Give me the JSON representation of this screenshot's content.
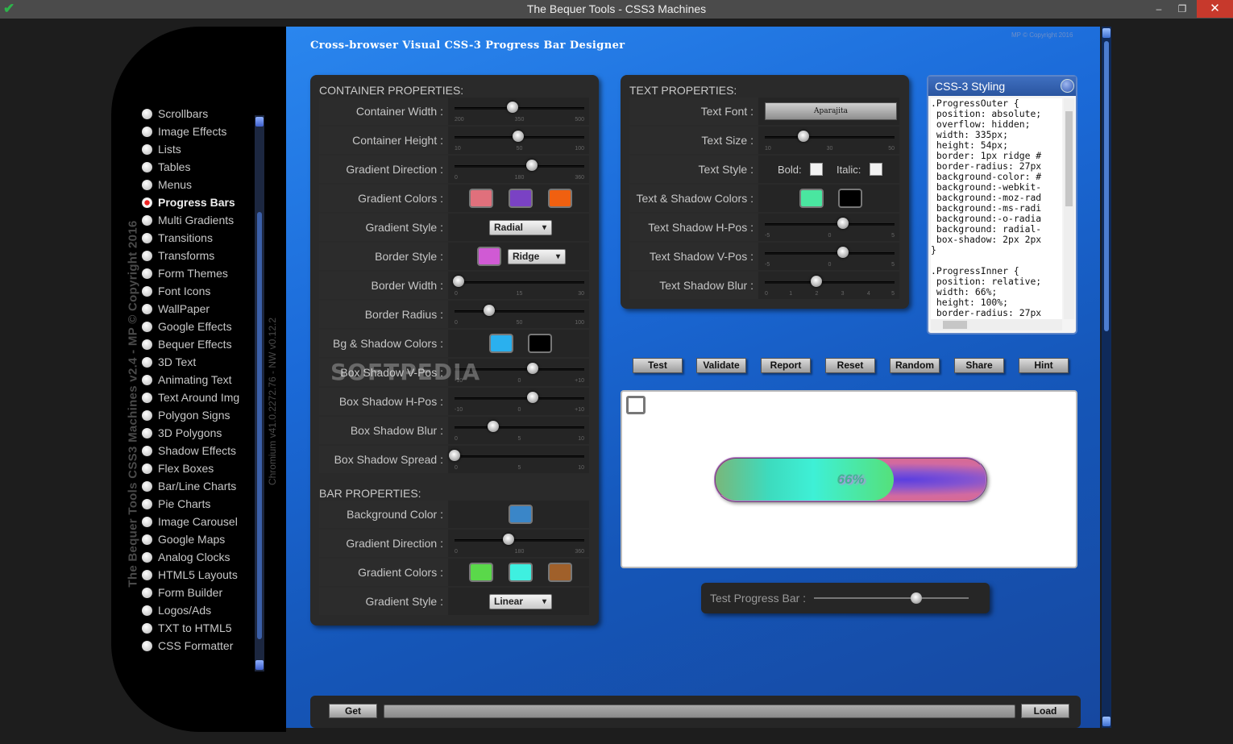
{
  "window": {
    "title": "The Bequer Tools - CSS3 Machines",
    "min": "–",
    "max": "❐",
    "close": "✕",
    "check": "✔"
  },
  "sidebar": {
    "vertical_title": "The Bequer Tools CSS3 Machines v2.4 - MP © Copyright 2016",
    "vertical_version": "Chromium v41.0.2272.76 - NW v0.12.2",
    "items": [
      {
        "label": "Scrollbars"
      },
      {
        "label": "Image Effects"
      },
      {
        "label": "Lists"
      },
      {
        "label": "Tables"
      },
      {
        "label": "Menus"
      },
      {
        "label": "Progress Bars"
      },
      {
        "label": "Multi Gradients"
      },
      {
        "label": "Transitions"
      },
      {
        "label": "Transforms"
      },
      {
        "label": "Form Themes"
      },
      {
        "label": "Font Icons"
      },
      {
        "label": "WallPaper"
      },
      {
        "label": "Google Effects"
      },
      {
        "label": "Bequer Effects"
      },
      {
        "label": "3D Text"
      },
      {
        "label": "Animating Text"
      },
      {
        "label": "Text Around Img"
      },
      {
        "label": "Polygon Signs"
      },
      {
        "label": "3D Polygons"
      },
      {
        "label": "Shadow Effects"
      },
      {
        "label": "Flex Boxes"
      },
      {
        "label": "Bar/Line Charts"
      },
      {
        "label": "Pie Charts"
      },
      {
        "label": "Image Carousel"
      },
      {
        "label": "Google Maps"
      },
      {
        "label": "Analog Clocks"
      },
      {
        "label": "HTML5 Layouts"
      },
      {
        "label": "Form Builder"
      },
      {
        "label": "Logos/Ads"
      },
      {
        "label": "TXT to HTML5"
      },
      {
        "label": "CSS Formatter"
      }
    ],
    "active": "Progress Bars"
  },
  "main": {
    "title": "Cross-browser Visual CSS-3 Progress Bar Designer",
    "copyright": "MP © Copyright 2016"
  },
  "container": {
    "header": "Container Properties:",
    "width": {
      "label": "Container Width :",
      "min": "200",
      "mid": "350",
      "max": "500",
      "value": 335
    },
    "height": {
      "label": "Container Height :",
      "min": "10",
      "mid": "50",
      "max": "100",
      "value": 54
    },
    "grad_dir": {
      "label": "Gradient Direction :",
      "min": "0",
      "mid": "180",
      "max": "360",
      "value": 215
    },
    "grad_colors": {
      "label": "Gradient Colors :",
      "c1": "#e0707c",
      "c2": "#7a42c4",
      "c3": "#f06010"
    },
    "grad_style": {
      "label": "Gradient Style :",
      "value": "Radial"
    },
    "border_style": {
      "label": "Border Style :",
      "color": "#d05ad4",
      "value": "Ridge"
    },
    "border_width": {
      "label": "Border Width :",
      "min": "0",
      "mid": "15",
      "max": "30",
      "value": 1
    },
    "border_radius": {
      "label": "Border Radius :",
      "min": "0",
      "mid": "50",
      "max": "100",
      "value": 27
    },
    "bg_shadow": {
      "label": "Bg & Shadow Colors :",
      "c1": "#2ab0ee",
      "c2": "#000000"
    },
    "shadow_v": {
      "label": "Box Shadow V-Pos :",
      "min": "-10",
      "mid": "0",
      "max": "+10",
      "value": 2
    },
    "shadow_h": {
      "label": "Box Shadow H-Pos :",
      "min": "-10",
      "mid": "0",
      "max": "+10",
      "value": 2
    },
    "shadow_blur": {
      "label": "Box Shadow Blur :",
      "min": "0",
      "mid": "5",
      "max": "10",
      "value": 3
    },
    "shadow_spread": {
      "label": "Box Shadow Spread :",
      "min": "0",
      "mid": "5",
      "max": "10",
      "value": 0
    }
  },
  "bar": {
    "header": "Bar Properties:",
    "bg_color": {
      "label": "Background Color :",
      "color": "#3a86c8"
    },
    "grad_dir": {
      "label": "Gradient Direction :",
      "min": "0",
      "mid": "180",
      "max": "360",
      "value": 150
    },
    "grad_colors": {
      "label": "Gradient Colors :",
      "c1": "#5ad84a",
      "c2": "#3ef0e0",
      "c3": "#a0602a"
    },
    "grad_style": {
      "label": "Gradient Style :",
      "value": "Linear"
    }
  },
  "text": {
    "header": "Text Properties:",
    "font": {
      "label": "Text Font :",
      "value": "Aparajita"
    },
    "size": {
      "label": "Text Size :",
      "min": "10",
      "mid": "30",
      "max": "50",
      "value": 22
    },
    "style": {
      "label": "Text Style :",
      "bold": "Bold:",
      "italic": "Italic:"
    },
    "colors": {
      "label": "Text & Shadow Colors :",
      "c1": "#4ae6a0",
      "c2": "#000000"
    },
    "shadow_h": {
      "label": "Text Shadow H-Pos :",
      "min": "-5",
      "mid": "0",
      "max": "5",
      "value": 1
    },
    "shadow_v": {
      "label": "Text Shadow V-Pos :",
      "min": "-5",
      "mid": "0",
      "max": "5",
      "value": 1
    },
    "shadow_blur": {
      "label": "Text Shadow Blur :",
      "ticks": [
        "0",
        "1",
        "2",
        "3",
        "4",
        "5"
      ],
      "value": 2
    }
  },
  "css_panel": {
    "title": "CSS-3 Styling",
    "code": ".ProgressOuter {\n position: absolute;\n overflow: hidden;\n width: 335px;\n height: 54px;\n border: 1px ridge #\n border-radius: 27px\n background-color: #\n background:-webkit-\n background:-moz-rad\n background:-ms-radi\n background:-o-radia\n background: radial-\n box-shadow: 2px 2px\n}\n\n.ProgressInner {\n position: relative;\n width: 66%;\n height: 100%;\n border-radius: 27px"
  },
  "actions": [
    "Test",
    "Validate",
    "Report",
    "Reset",
    "Random",
    "Share",
    "Hint"
  ],
  "preview": {
    "progress": 66,
    "text": "66%"
  },
  "test_bar": {
    "label": "Test Progress Bar :",
    "value": 66
  },
  "bottom": {
    "get": "Get",
    "load": "Load"
  },
  "watermark": "SOFTPEDIA"
}
